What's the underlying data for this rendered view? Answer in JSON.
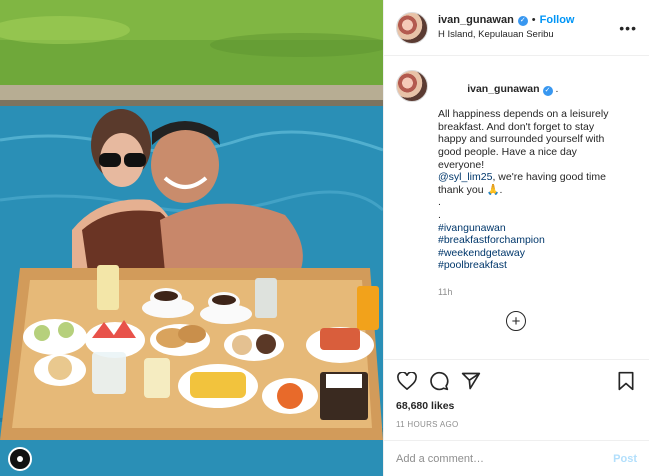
{
  "post": {
    "username": "ivan_gunawan",
    "separator": "•",
    "follow_label": "Follow",
    "location": "H Island, Kepulauan Seribu",
    "verified_icon": "verified-badge-icon",
    "more_icon": "more-options-icon",
    "caption_lines": [
      "All happiness depends on a leisurely",
      "breakfast. And don't forget to stay",
      "happy and surrounded yourself with",
      "good people. Have a nice day",
      "everyone!"
    ],
    "mention": "@syl_lim25",
    "mention_rest": ", we're having good time",
    "thanks_line": "thank you 🙏.",
    "dots": [
      ".",
      "."
    ],
    "hashtags": [
      "#ivangunawan",
      "#breakfastforchampion",
      "#weekendgetaway",
      "#poolbreakfast"
    ],
    "time_ago": "11h",
    "likes": "68,680 likes",
    "posted_ago": "11 HOURS AGO",
    "comment_placeholder": "Add a comment…",
    "post_label": "Post",
    "accent_color": "#0095f6",
    "link_color": "#00376b"
  },
  "icons": {
    "like": "heart-icon",
    "comment": "comment-icon",
    "share": "share-icon",
    "save": "bookmark-icon",
    "add": "plus-circle-icon"
  }
}
